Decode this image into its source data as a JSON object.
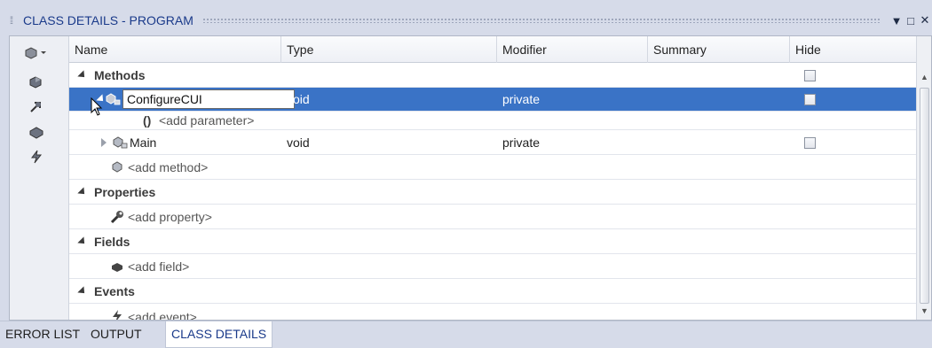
{
  "title": "CLASS DETAILS - PROGRAM",
  "window_controls": {
    "dropdown": "▼",
    "maximize": "□",
    "close": "✕"
  },
  "columns": [
    "Name",
    "Type",
    "Modifier",
    "Summary",
    "Hide"
  ],
  "groups": {
    "methods": "Methods",
    "properties": "Properties",
    "fields": "Fields",
    "events": "Events"
  },
  "methods": [
    {
      "name": "ConfigureCUI",
      "type": "void",
      "modifier": "private",
      "hide": false,
      "selected": true
    },
    {
      "name": "Main",
      "type": "void",
      "modifier": "private",
      "hide": false,
      "selected": false
    }
  ],
  "placeholders": {
    "add_parameter": "<add parameter>",
    "add_method": "<add method>",
    "add_property": "<add property>",
    "add_field": "<add field>",
    "add_event": "<add event>"
  },
  "param_glyph": "()",
  "bottom_tabs": [
    "ERROR LIST",
    "OUTPUT",
    "CLASS DETAILS"
  ],
  "active_tab": "CLASS DETAILS",
  "colors": {
    "selection": "#3a73c6",
    "title": "#1a3a8a",
    "chrome": "#d6dbe9"
  }
}
